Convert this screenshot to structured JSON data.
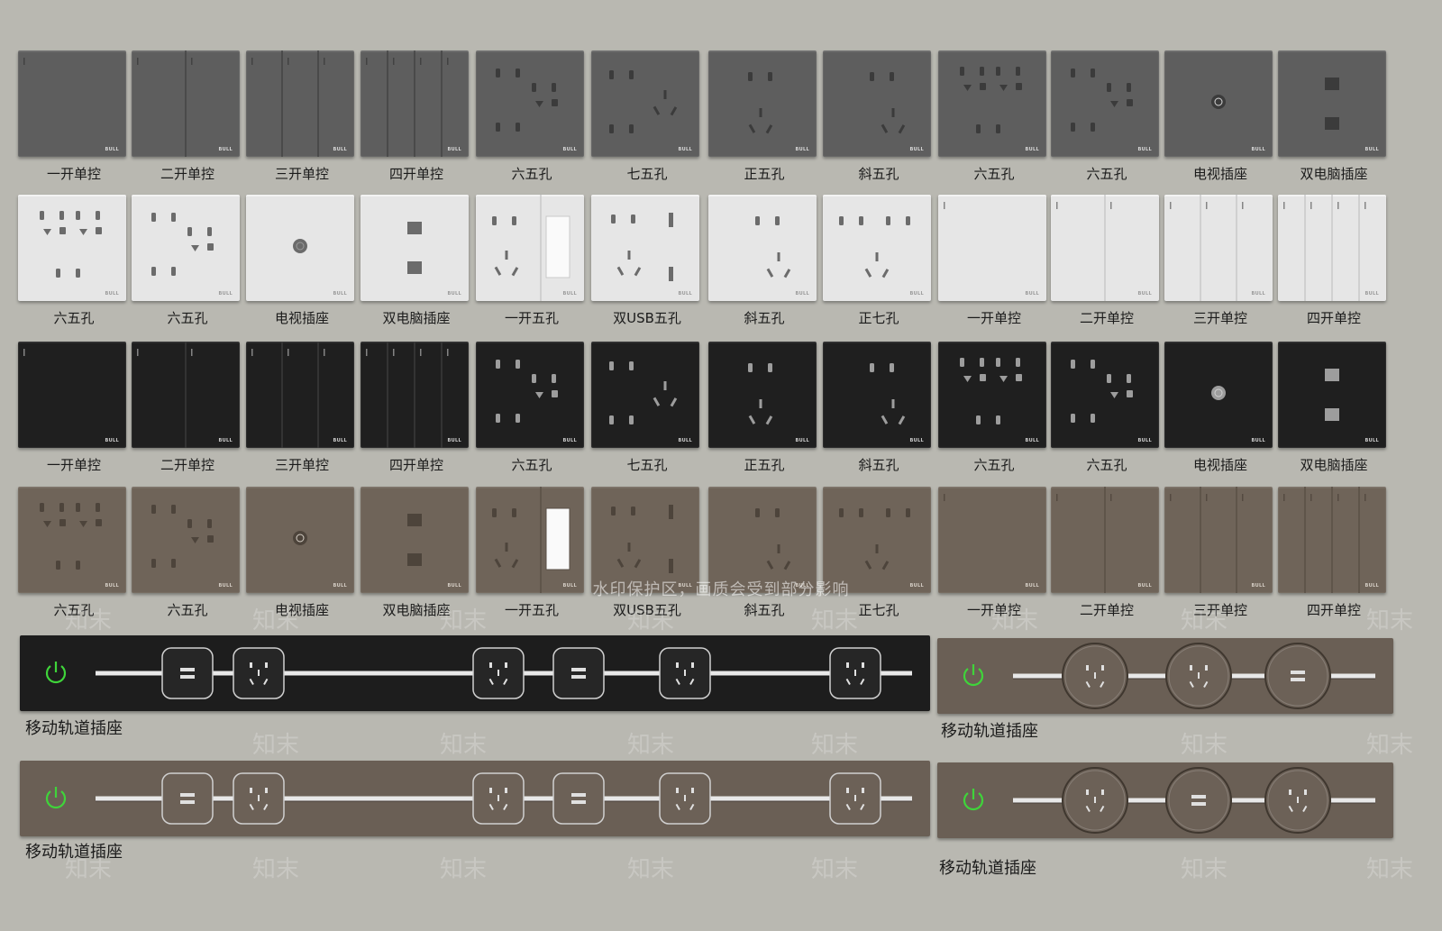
{
  "brand": "BULL",
  "watermark": {
    "banner": "水印保护区，画质会受到部分影响",
    "mark": "知末"
  },
  "rows": [
    {
      "finish": "grey",
      "items": [
        {
          "type": "switch1",
          "label": "一开单控"
        },
        {
          "type": "switch2",
          "label": "二开单控"
        },
        {
          "type": "switch3",
          "label": "三开单控"
        },
        {
          "type": "switch4",
          "label": "四开单控"
        },
        {
          "type": "six5a",
          "label": "六五孔"
        },
        {
          "type": "seven5",
          "label": "七五孔"
        },
        {
          "type": "zheng5",
          "label": "正五孔"
        },
        {
          "type": "xie5",
          "label": "斜五孔"
        },
        {
          "type": "six5b",
          "label": "六五孔"
        },
        {
          "type": "six5a",
          "label": "六五孔"
        },
        {
          "type": "tv",
          "label": "电视插座"
        },
        {
          "type": "dualpc",
          "label": "双电脑插座"
        }
      ]
    },
    {
      "finish": "white",
      "items": [
        {
          "type": "six5b",
          "label": "六五孔"
        },
        {
          "type": "six5a",
          "label": "六五孔"
        },
        {
          "type": "tv",
          "label": "电视插座"
        },
        {
          "type": "dualpc",
          "label": "双电脑插座"
        },
        {
          "type": "switch1five",
          "label": "一开五孔"
        },
        {
          "type": "usb5",
          "label": "双USB五孔"
        },
        {
          "type": "xie5",
          "label": "斜五孔"
        },
        {
          "type": "zheng7",
          "label": "正七孔"
        },
        {
          "type": "switch1",
          "label": "一开单控"
        },
        {
          "type": "switch2",
          "label": "二开单控"
        },
        {
          "type": "switch3",
          "label": "三开单控"
        },
        {
          "type": "switch4",
          "label": "四开单控"
        }
      ]
    },
    {
      "finish": "black",
      "items": [
        {
          "type": "switch1",
          "label": "一开单控"
        },
        {
          "type": "switch2",
          "label": "二开单控"
        },
        {
          "type": "switch3",
          "label": "三开单控"
        },
        {
          "type": "switch4",
          "label": "四开单控"
        },
        {
          "type": "six5a",
          "label": "六五孔"
        },
        {
          "type": "seven5",
          "label": "七五孔"
        },
        {
          "type": "zheng5",
          "label": "正五孔"
        },
        {
          "type": "xie5",
          "label": "斜五孔"
        },
        {
          "type": "six5b",
          "label": "六五孔"
        },
        {
          "type": "six5a",
          "label": "六五孔"
        },
        {
          "type": "tv",
          "label": "电视插座"
        },
        {
          "type": "dualpc",
          "label": "双电脑插座"
        }
      ]
    },
    {
      "finish": "brown",
      "items": [
        {
          "type": "six5b",
          "label": "六五孔"
        },
        {
          "type": "six5a",
          "label": "六五孔"
        },
        {
          "type": "tv",
          "label": "电视插座"
        },
        {
          "type": "dualpc",
          "label": "双电脑插座"
        },
        {
          "type": "switch1five",
          "label": "一开五孔"
        },
        {
          "type": "usb5",
          "label": "双USB五孔"
        },
        {
          "type": "xie5",
          "label": "斜五孔"
        },
        {
          "type": "zheng7",
          "label": "正七孔"
        },
        {
          "type": "switch1",
          "label": "一开单控"
        },
        {
          "type": "switch2",
          "label": "二开单控"
        },
        {
          "type": "switch3",
          "label": "三开单控"
        },
        {
          "type": "switch4",
          "label": "四开单控"
        }
      ]
    }
  ],
  "tracks": [
    {
      "label": "移动轨道插座",
      "finish": "black",
      "style": "square",
      "modules": [
        "usb",
        "outlet",
        "outlet",
        "usb",
        "outlet",
        "outlet"
      ]
    },
    {
      "label": "移动轨道插座",
      "finish": "brown",
      "style": "round",
      "modules": [
        "outlet",
        "outlet",
        "usb"
      ]
    },
    {
      "label": "移动轨道插座",
      "finish": "brown",
      "style": "square",
      "modules": [
        "usb",
        "outlet",
        "outlet",
        "usb",
        "outlet",
        "outlet"
      ]
    },
    {
      "label": "移动轨道插座",
      "finish": "brown",
      "style": "round",
      "modules": [
        "outlet",
        "usb",
        "outlet"
      ]
    }
  ],
  "colors": {
    "background": "#b9b8b1",
    "grey": "#5e5e5e",
    "white": "#e6e6e6",
    "black": "#1f1f1f",
    "brown": "#6f6459",
    "power_led": "#3fd43a"
  }
}
